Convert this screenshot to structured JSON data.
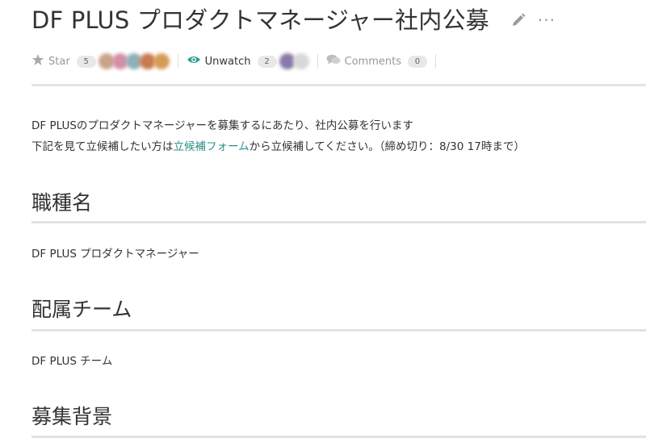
{
  "page": {
    "title": "DF PLUS プロダクトマネージャー社内公募",
    "more_glyph": "···"
  },
  "meta": {
    "star_label": "Star",
    "star_count": "5",
    "unwatch_label": "Unwatch",
    "watch_count": "2",
    "comments_label": "Comments",
    "comments_count": "0",
    "star_avatars": [
      "#c9a48a",
      "#d48fa6",
      "#8fb0b8",
      "#c97a4f",
      "#d79a58"
    ],
    "watch_avatars": [
      "#8a7aa8",
      "#d8d8d8"
    ]
  },
  "intro": {
    "line1": "DF PLUSのプロダクトマネージャーを募集するにあたり、社内公募を行います",
    "line2_prefix": "下記を見て立候補したい方は",
    "line2_link": "立候補フォーム",
    "line2_suffix": "から立候補してください。（締め切り：8/30 17時まで）"
  },
  "sections": [
    {
      "heading": "職種名",
      "body": "DF PLUS プロダクトマネージャー"
    },
    {
      "heading": "配属チーム",
      "body": "DF PLUS チーム"
    },
    {
      "heading": "募集背景",
      "body": ""
    }
  ],
  "colors": {
    "link": "#2a8f8a",
    "icon_gray": "#aaaaaa",
    "eye_teal": "#2a9d8f"
  }
}
